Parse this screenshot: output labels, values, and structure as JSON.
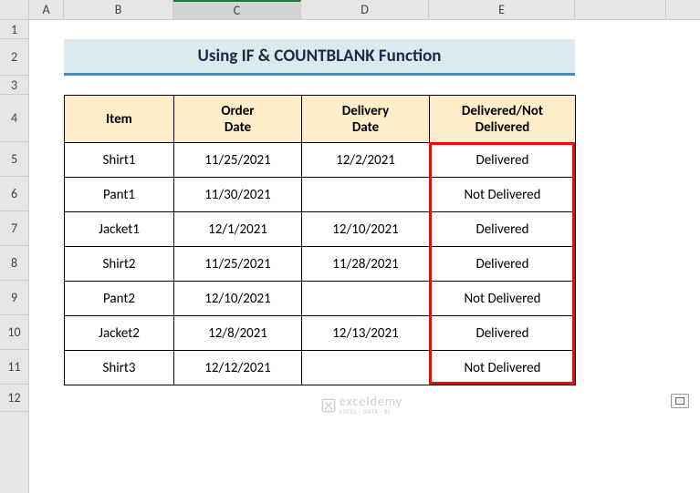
{
  "columns": [
    "A",
    "B",
    "C",
    "D",
    "E"
  ],
  "rows": [
    "1",
    "2",
    "3",
    "4",
    "5",
    "6",
    "7",
    "8",
    "9",
    "10",
    "11",
    "12"
  ],
  "title": "Using IF & COUNTBLANK Function",
  "headers": {
    "item": "Item",
    "order": "Order Date",
    "delivery": "Delivery Date",
    "status": "Delivered/Not Delivered"
  },
  "data": [
    {
      "item": "Shirt1",
      "order": "11/25/2021",
      "delivery": "12/2/2021",
      "status": "Delivered"
    },
    {
      "item": "Pant1",
      "order": "11/30/2021",
      "delivery": "",
      "status": "Not Delivered"
    },
    {
      "item": "Jacket1",
      "order": "12/1/2021",
      "delivery": "12/10/2021",
      "status": "Delivered"
    },
    {
      "item": "Shirt2",
      "order": "11/25/2021",
      "delivery": "11/28/2021",
      "status": "Delivered"
    },
    {
      "item": "Pant2",
      "order": "12/10/2021",
      "delivery": "",
      "status": "Not Delivered"
    },
    {
      "item": "Jacket2",
      "order": "12/8/2021",
      "delivery": "12/13/2021",
      "status": "Delivered"
    },
    {
      "item": "Shirt3",
      "order": "12/12/2021",
      "delivery": "",
      "status": "Not Delivered"
    }
  ],
  "watermark": {
    "main": "exceldemy",
    "sub": "EXCEL · DATA · BI"
  }
}
